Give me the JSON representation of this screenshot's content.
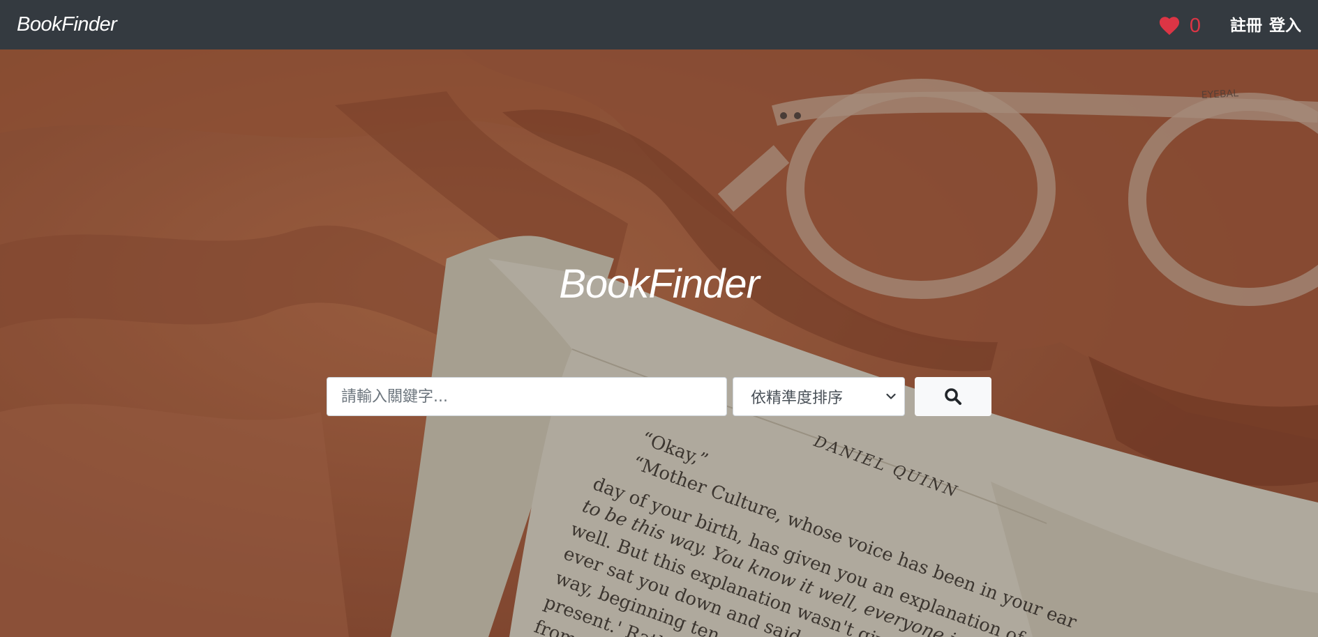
{
  "navbar": {
    "brand": "BookFinder",
    "favorites_count": "0",
    "register_label": "註冊",
    "login_label": "登入"
  },
  "hero": {
    "title": "BookFinder",
    "book_text": {
      "line_okay": "“Okay,”",
      "line_1": "“Mother Culture, whose voice has been in your ear",
      "line_2": "day of your birth, has given you an explanation of",
      "line_3": "to be this way. You know it well, everyone in",
      "line_4": "well. But this explanation wasn't given",
      "line_5": "ever sat you down and said,",
      "line_6": "way, beginning ten",
      "line_7": "present.' Rath",
      "line_8": "from a",
      "author": "DANIEL QUINN",
      "glasses_brand": "EYEBAL"
    }
  },
  "search": {
    "placeholder": "請輸入關鍵字...",
    "sort_selected": "依精準度排序",
    "icon": "search-icon"
  },
  "colors": {
    "navbar": "#343a40",
    "heart": "#dc3545",
    "hero_fabric": "#b86a47",
    "page": "#d8d2c2"
  }
}
